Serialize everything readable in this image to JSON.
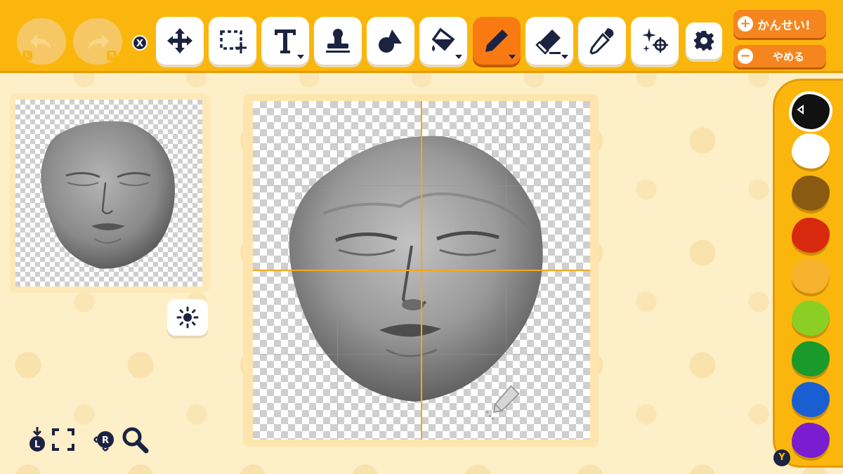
{
  "nav": {
    "undo_icon": "undo-arrow-icon",
    "undo_shoulder": "L",
    "redo_icon": "redo-arrow-icon",
    "redo_shoulder": "R",
    "close_badge": "X"
  },
  "toolbar": {
    "tools": [
      {
        "name": "move",
        "icon": "move-arrows-icon",
        "active": false
      },
      {
        "name": "select",
        "icon": "selection-box-icon",
        "active": false
      },
      {
        "name": "text",
        "icon": "text-icon",
        "active": false,
        "dropdown": true
      },
      {
        "name": "stamp",
        "icon": "stamp-icon",
        "active": false
      },
      {
        "name": "shape",
        "icon": "shapes-icon",
        "active": false
      },
      {
        "name": "fill",
        "icon": "paint-bucket-icon",
        "active": false,
        "dropdown": true
      },
      {
        "name": "pen",
        "icon": "pen-icon",
        "active": true,
        "dropdown": true
      },
      {
        "name": "eraser",
        "icon": "eraser-icon",
        "active": false,
        "dropdown": true
      },
      {
        "name": "eyedropper",
        "icon": "eyedropper-icon",
        "active": false
      },
      {
        "name": "effects",
        "icon": "sparkle-icon",
        "active": false
      },
      {
        "name": "settings",
        "icon": "gear-icon",
        "active": false
      }
    ]
  },
  "actions": {
    "done_label": "かんせい!",
    "done_icon": "+",
    "cancel_label": "やめる",
    "cancel_icon": "−"
  },
  "palette": {
    "colors": [
      "#111111",
      "#ffffff",
      "#8a5a12",
      "#d8290f",
      "#f6b12d",
      "#8ccf24",
      "#1a9a2a",
      "#1a5fd1",
      "#7a1dd0"
    ],
    "selected_index": 0,
    "toggle_badge": "Y"
  },
  "bottom_controls": {
    "zoom_shoulder": "L",
    "pan_shoulder": "R"
  },
  "colors": {
    "toolbar_bg": "#fbb60d",
    "active_tool": "#f97a13",
    "page_bg": "#fdefc8",
    "icon_dark": "#1c2341"
  }
}
